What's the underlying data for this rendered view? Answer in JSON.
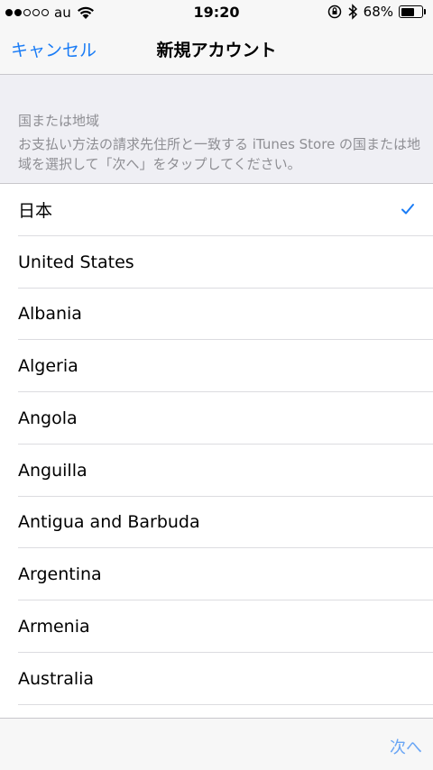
{
  "status_bar": {
    "carrier": "au",
    "time": "19:20",
    "battery_percent": "68%",
    "battery_level": 0.68,
    "signal_bars_filled": 2,
    "signal_bars_total": 5
  },
  "nav": {
    "cancel_label": "キャンセル",
    "title": "新規アカウント"
  },
  "section": {
    "title": "国または地域",
    "description": "お支払い方法の請求先住所と一致する iTunes Store の国または地域を選択して「次へ」をタップしてください。"
  },
  "countries": [
    {
      "name": "日本",
      "selected": true
    },
    {
      "name": "United States",
      "selected": false
    },
    {
      "name": "Albania",
      "selected": false
    },
    {
      "name": "Algeria",
      "selected": false
    },
    {
      "name": "Angola",
      "selected": false
    },
    {
      "name": "Anguilla",
      "selected": false
    },
    {
      "name": "Antigua and Barbuda",
      "selected": false
    },
    {
      "name": "Argentina",
      "selected": false
    },
    {
      "name": "Armenia",
      "selected": false
    },
    {
      "name": "Australia",
      "selected": false
    }
  ],
  "toolbar": {
    "next_label": "次へ"
  },
  "colors": {
    "accent": "#1a7cf6",
    "next_disabled": "#6aa6f5",
    "secondary_text": "#8e8e93",
    "group_background": "#efeff4"
  },
  "icons": {
    "wifi": "wifi-icon",
    "rotation_lock": "rotation-lock-icon",
    "bluetooth": "bluetooth-icon",
    "battery": "battery-icon",
    "checkmark": "checkmark-icon"
  }
}
